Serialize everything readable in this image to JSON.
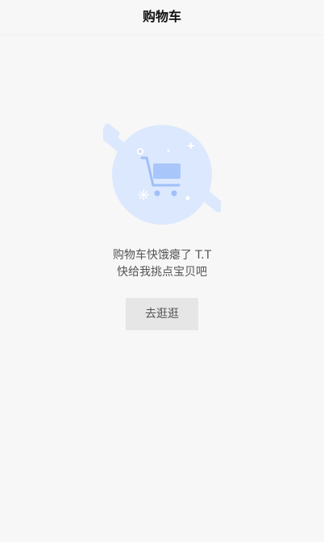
{
  "header": {
    "title": "购物车"
  },
  "empty_state": {
    "illustration_icon": "empty-cart-icon",
    "line1": "购物车快饿瘪了 T.T",
    "line2": "快给我挑点宝贝吧",
    "button_label": "去逛逛"
  },
  "colors": {
    "background": "#f7f7f7",
    "illustration_circle": "#dbe8fd",
    "illustration_accent": "#9fc0f9",
    "button_bg": "#e6e6e6",
    "text": "#555555"
  }
}
